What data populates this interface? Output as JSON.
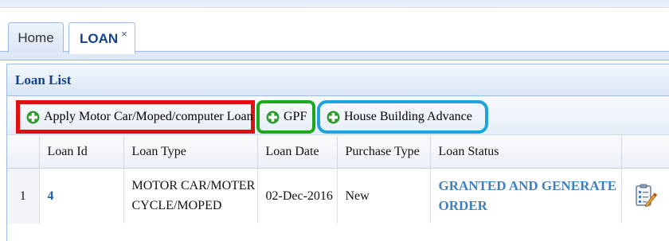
{
  "tabs": {
    "home_label": "Home",
    "loan_label": "LOAN",
    "close_glyph": "×"
  },
  "panel": {
    "title": "Loan List"
  },
  "toolbar": {
    "buttons": [
      {
        "label": "Apply Motor Car/Moped/computer Loan",
        "icon": "green-cross-add-icon",
        "highlight": "#e01010"
      },
      {
        "label": "GPF",
        "icon": "green-cross-add-icon",
        "highlight": "#1ea81e"
      },
      {
        "label": "House Building Advance",
        "icon": "green-cross-add-icon",
        "highlight": "#1ea4dc"
      }
    ]
  },
  "grid": {
    "columns": [
      "Loan Id",
      "Loan Type",
      "Loan Date",
      "Purchase Type",
      "Loan Status"
    ],
    "rows": [
      {
        "row_number": "1",
        "loan_id": "4",
        "loan_type": "MOTOR CAR/MOTER CYCLE/MOPED",
        "loan_date": "02-Dec-2016",
        "purchase_type": "New",
        "loan_status": "GRANTED AND GENERATE ORDER",
        "action_icon": "edit-form-icon"
      }
    ]
  },
  "colors": {
    "accent": "#15428b",
    "link": "#1f5fa8",
    "status": "#3f7fbd"
  }
}
